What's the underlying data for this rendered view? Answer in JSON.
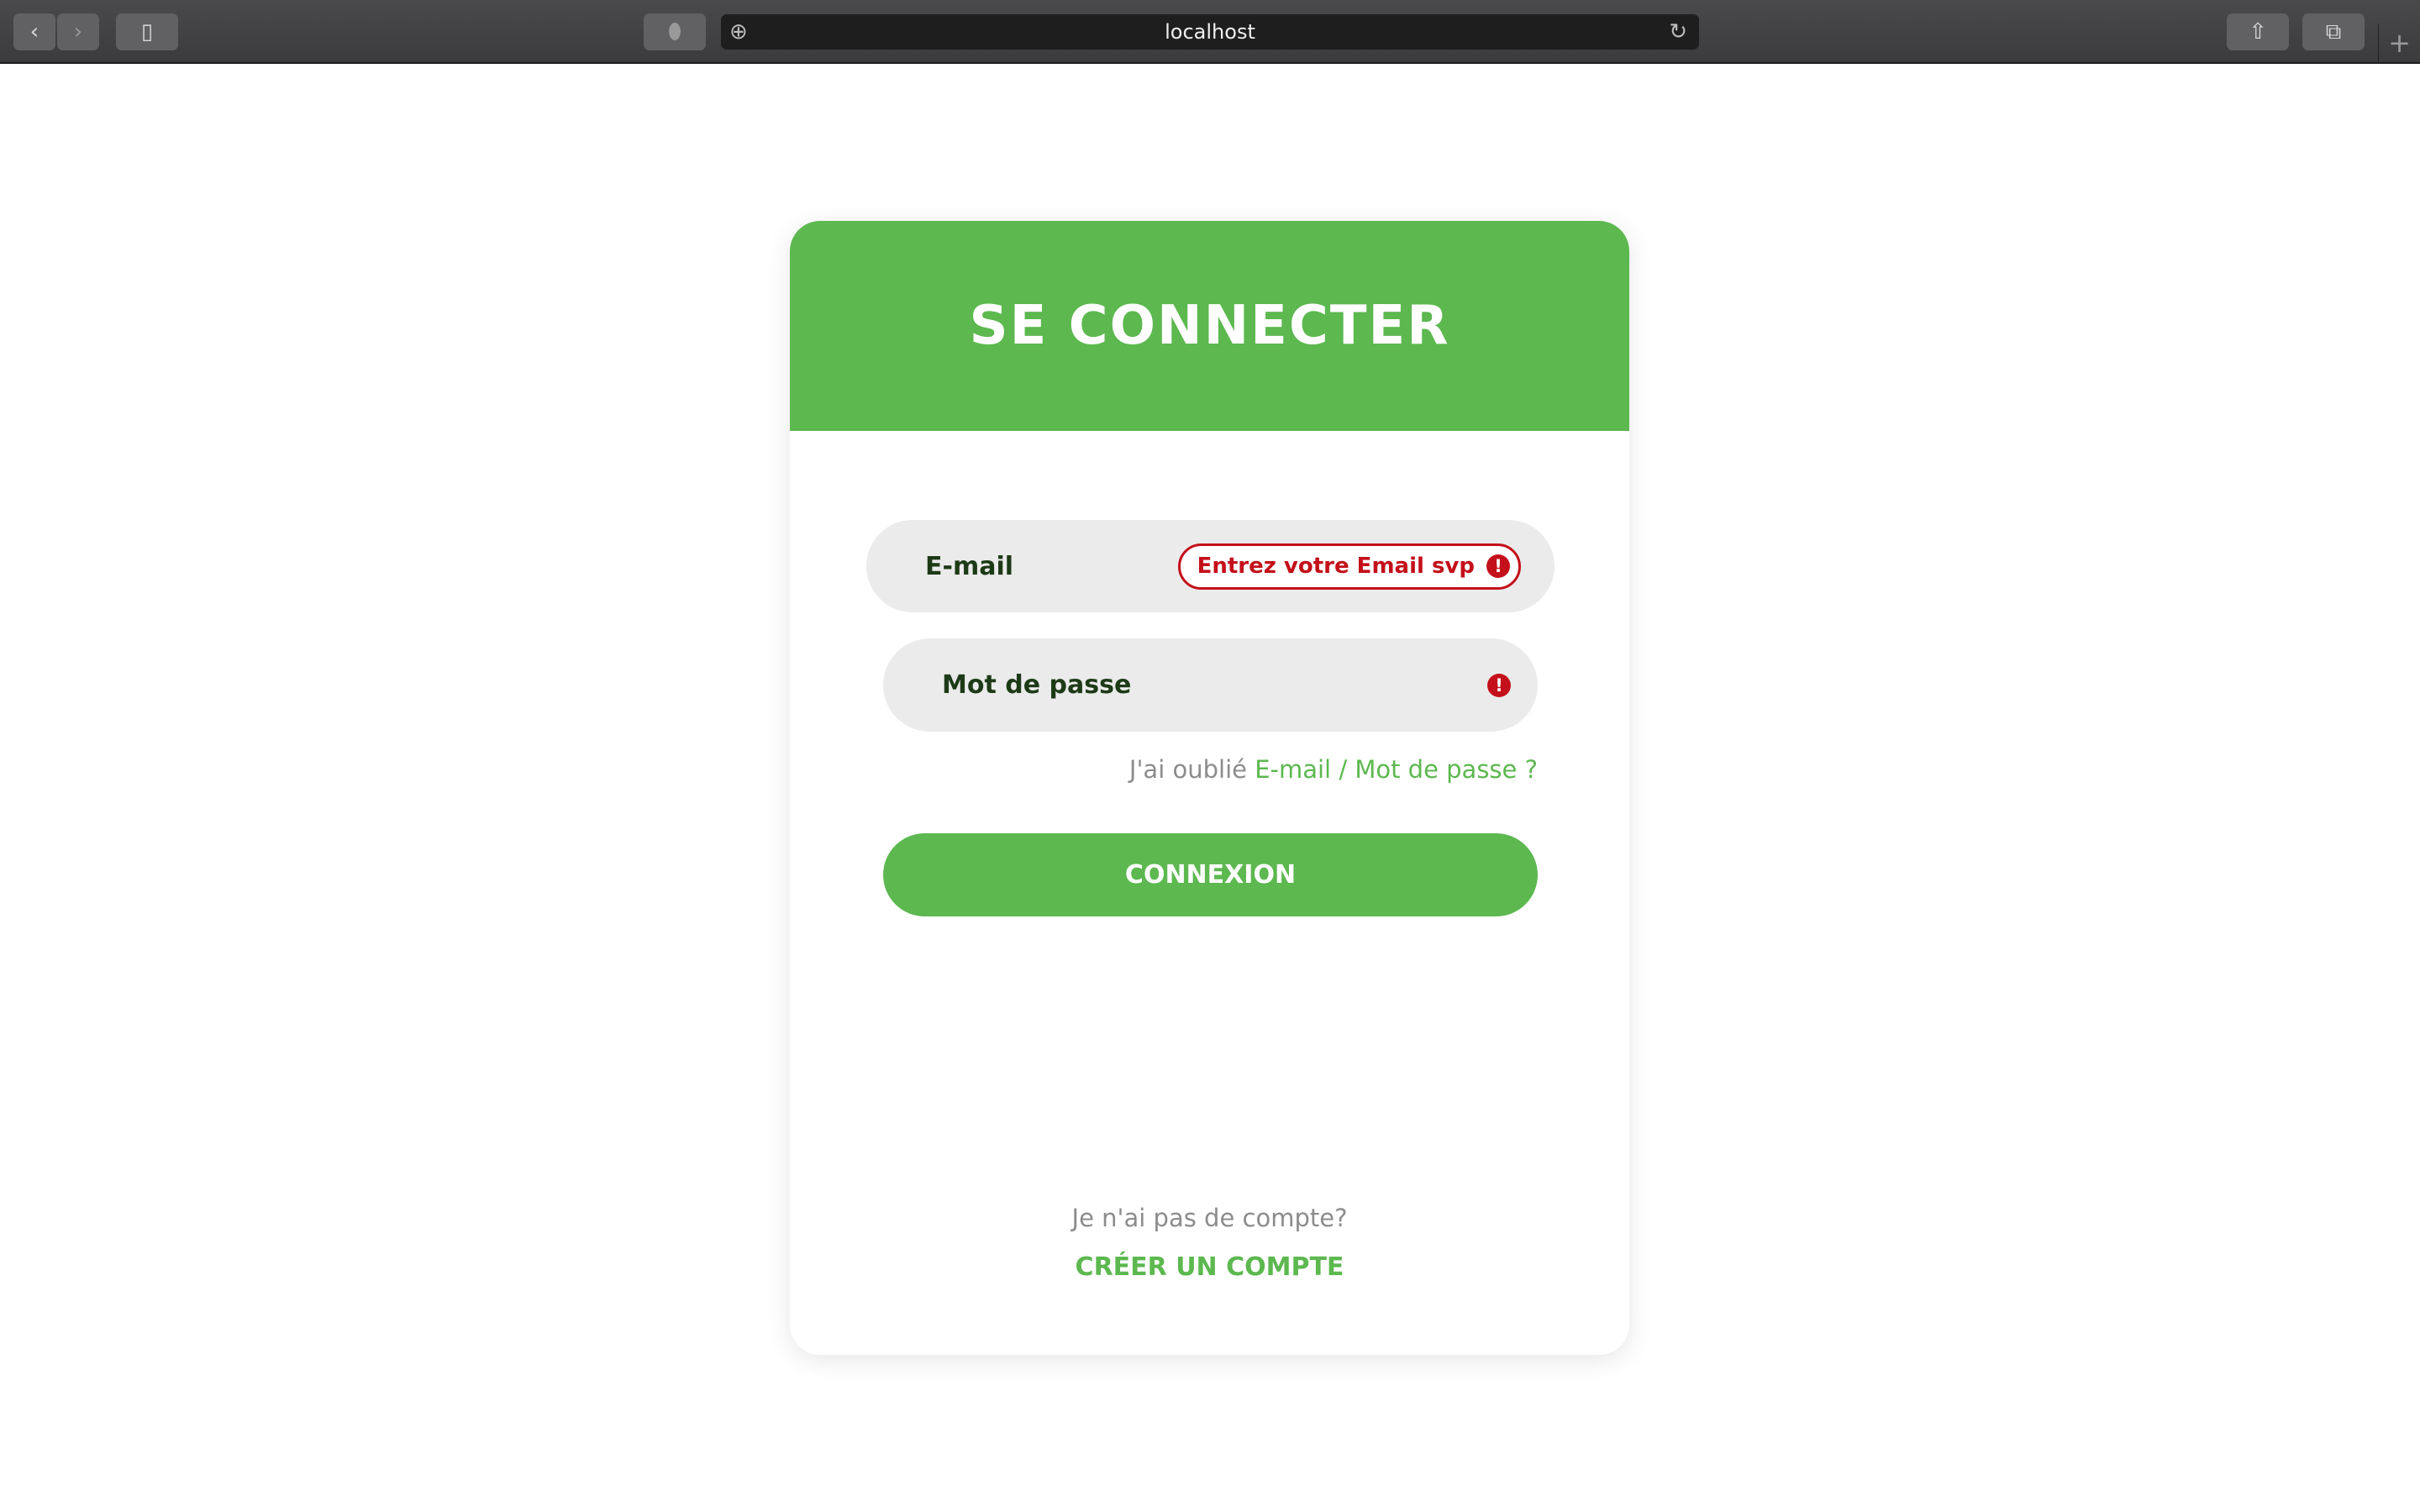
{
  "browser": {
    "url": "localhost"
  },
  "login": {
    "title": "SE CONNECTER",
    "email_label": "E-mail",
    "email_error": "Entrez votre Email svp",
    "password_label": "Mot de passe",
    "forgot_prefix": "J'ai oublié",
    "forgot_link": "E-mail / Mot de passe ?",
    "submit": "CONNEXION",
    "no_account": "Je n'ai pas de compte?",
    "create_account": "CRÉER UN COMPTE"
  },
  "colors": {
    "accent": "#5cb84f",
    "error": "#c4101a"
  }
}
